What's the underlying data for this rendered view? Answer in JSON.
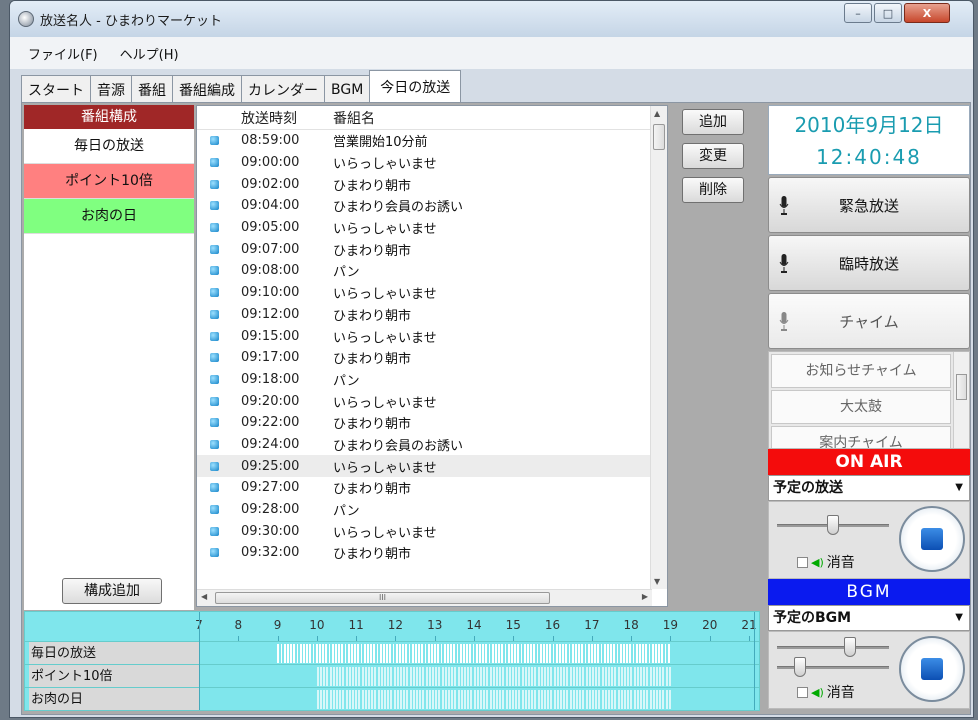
{
  "window": {
    "title": "放送名人 - ひまわりマーケット",
    "buttons": [
      "–",
      "□",
      "X"
    ]
  },
  "menu": [
    "ファイル(F)",
    "ヘルプ(H)"
  ],
  "tabs": [
    "スタート",
    "音源",
    "番組",
    "番組編成",
    "カレンダー",
    "BGM",
    "今日の放送"
  ],
  "active_tab": "今日の放送",
  "program_panel": {
    "header": "番組構成",
    "items": [
      {
        "label": "毎日の放送",
        "color": "#ffffff"
      },
      {
        "label": "ポイント10倍",
        "color": "#ff8080"
      },
      {
        "label": "お肉の日",
        "color": "#80ff80"
      }
    ],
    "add_button": "構成追加"
  },
  "schedule": {
    "col_time": "放送時刻",
    "col_name": "番組名",
    "rows": [
      {
        "time": "08:59:00",
        "name": "営業開始10分前"
      },
      {
        "time": "09:00:00",
        "name": "いらっしゃいませ"
      },
      {
        "time": "09:02:00",
        "name": "ひまわり朝市"
      },
      {
        "time": "09:04:00",
        "name": "ひまわり会員のお誘い"
      },
      {
        "time": "09:05:00",
        "name": "いらっしゃいませ"
      },
      {
        "time": "09:07:00",
        "name": "ひまわり朝市"
      },
      {
        "time": "09:08:00",
        "name": "パン"
      },
      {
        "time": "09:10:00",
        "name": "いらっしゃいませ"
      },
      {
        "time": "09:12:00",
        "name": "ひまわり朝市"
      },
      {
        "time": "09:15:00",
        "name": "いらっしゃいませ"
      },
      {
        "time": "09:17:00",
        "name": "ひまわり朝市"
      },
      {
        "time": "09:18:00",
        "name": "パン"
      },
      {
        "time": "09:20:00",
        "name": "いらっしゃいませ"
      },
      {
        "time": "09:22:00",
        "name": "ひまわり朝市"
      },
      {
        "time": "09:24:00",
        "name": "ひまわり会員のお誘い"
      },
      {
        "time": "09:25:00",
        "name": "いらっしゃいませ",
        "selected": true
      },
      {
        "time": "09:27:00",
        "name": "ひまわり朝市"
      },
      {
        "time": "09:28:00",
        "name": "パン"
      },
      {
        "time": "09:30:00",
        "name": "いらっしゃいませ"
      },
      {
        "time": "09:32:00",
        "name": "ひまわり朝市"
      }
    ]
  },
  "actions": {
    "add": "追加",
    "edit": "変更",
    "delete": "削除"
  },
  "datetime": {
    "date": "2010年9月12日",
    "time": "12:40:48"
  },
  "broadcast_buttons": {
    "emergency": "緊急放送",
    "temporary": "臨時放送",
    "chime": "チャイム"
  },
  "chime_list": [
    "お知らせチャイム",
    "大太鼓",
    "案内チャイム"
  ],
  "onair": {
    "label": "ON AIR",
    "select": "予定の放送",
    "mute": "消音",
    "volume": 0.45
  },
  "bgm": {
    "label": "BGM",
    "select": "予定のBGM",
    "mute": "消音",
    "volume": 0.6,
    "balance": 0.15
  },
  "timeline": {
    "hours": [
      7,
      8,
      9,
      10,
      11,
      12,
      13,
      14,
      15,
      16,
      17,
      18,
      19,
      20,
      21
    ],
    "rows": [
      "毎日の放送",
      "ポイント10倍",
      "お肉の日"
    ]
  },
  "colors": {
    "accent_red": "#f40c0c",
    "accent_blue": "#0a1aef",
    "date_teal": "#1a9cb0",
    "header_red": "#a02727",
    "timeline": "#7fe6ec"
  }
}
